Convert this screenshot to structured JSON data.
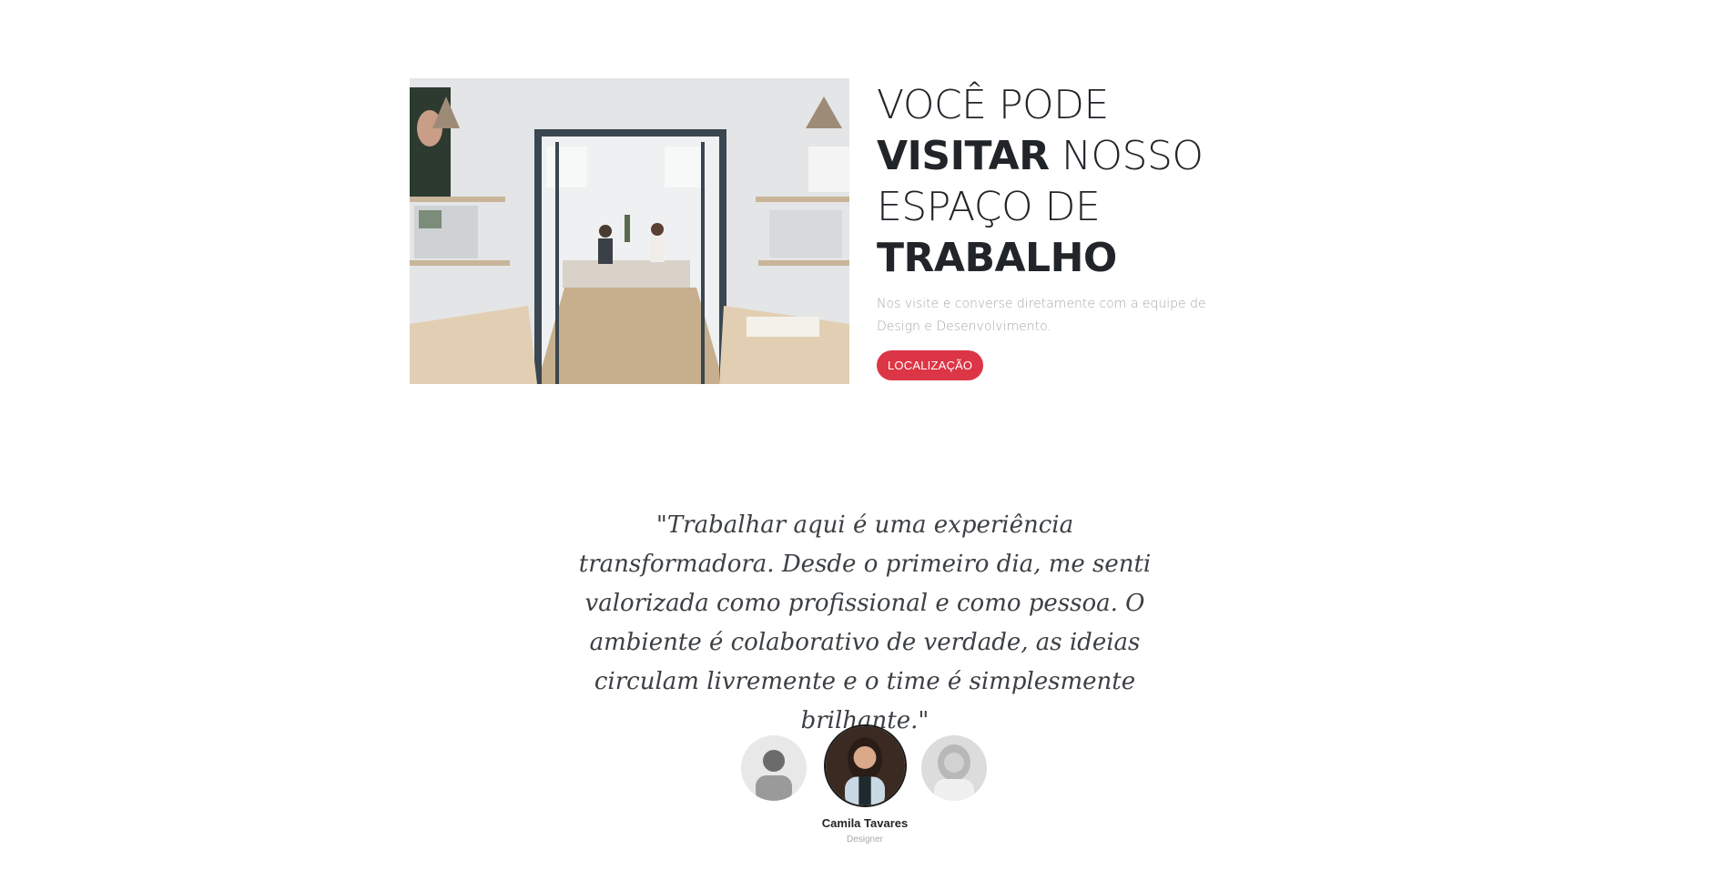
{
  "visit": {
    "title_line1": "VOCÊ PODE",
    "title_bold1": "VISITAR",
    "title_line2_rest": " NOSSO",
    "title_line3": "ESPAÇO DE",
    "title_bold2": "TRABALHO",
    "subtitle": "Nos visite e converse diretamente com a equipe de Design e Desenvolvimento.",
    "button_label": "LOCALIZAÇÃO",
    "accent_color": "#dc3545"
  },
  "testimonial": {
    "quote": "\"Trabalhar aqui é uma experiência transformadora. Desde o primeiro dia, me senti valorizada como profissional e como pessoa. O ambiente é colaborativo de verdade, as ideias circulam livremente e o time é simplesmente brilhante.\"",
    "active_person": {
      "name": "Camila Tavares",
      "role": "Designer"
    }
  }
}
